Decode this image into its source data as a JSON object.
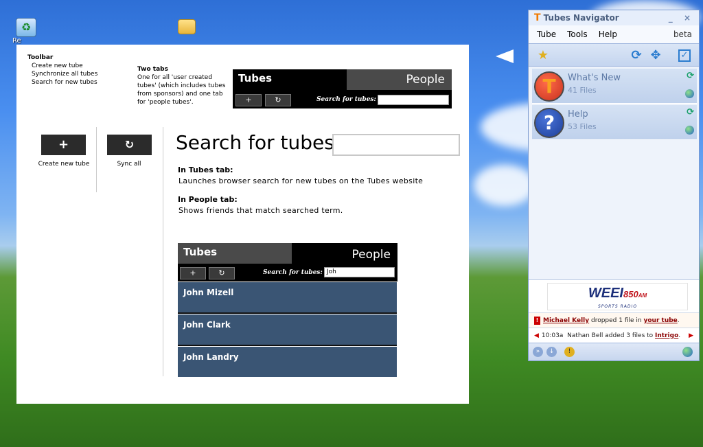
{
  "desktop": {
    "icons": [
      {
        "label": "Re"
      },
      {
        "label": ""
      }
    ]
  },
  "doc": {
    "toolbar_note": {
      "heading": "Toolbar",
      "lines": [
        "Create new tube",
        "Synchronize all tubes",
        "Search for new tubes"
      ]
    },
    "tabs_note": {
      "heading": "Two tabs",
      "lines": [
        "One for all 'user created",
        "tubes' (which includes tubes",
        "from sponsors) and one tab",
        "for 'people tubes'."
      ]
    },
    "mini_panel_top": {
      "tab_tubes": "Tubes",
      "tab_people": "People",
      "search_label": "Search for tubes:",
      "search_value": ""
    },
    "buttons": {
      "create_symbol": "+",
      "create_label": "Create new tube",
      "sync_symbol": "↻",
      "sync_label": "Sync all"
    },
    "search_heading": "Search for tubes",
    "search_value": "",
    "tubes_tab_heading": "In Tubes tab:",
    "tubes_tab_text": "Launches browser search for new tubes on the Tubes website",
    "people_tab_heading": "In People tab:",
    "people_tab_text": "Shows friends that match searched term.",
    "mini_panel_bottom": {
      "tab_tubes": "Tubes",
      "tab_people": "People",
      "search_label": "Search for tubes:",
      "search_value": "Joh"
    },
    "results": [
      "John Mizell",
      "John Clark",
      "John Landry"
    ]
  },
  "navigator": {
    "title": "Tubes Navigator",
    "title_controls": "_ ×",
    "menu": [
      "Tube",
      "Tools",
      "Help"
    ],
    "beta": "beta",
    "tubes": [
      {
        "name": "What's New",
        "files": "41 Files",
        "letter": "T",
        "color": "#c8321e"
      },
      {
        "name": "Help",
        "files": "53 Files",
        "letter": "?",
        "color": "#1d3f9a"
      }
    ],
    "ad": {
      "brand": "WEEI",
      "freq": "850",
      "unit": "AM",
      "tagline": "SPORTS RADIO"
    },
    "notice1": {
      "user": "Michael Kelly",
      "middle": " dropped 1 file in ",
      "target": "your tube",
      "end": "."
    },
    "notice2": {
      "time": "10:03a",
      "text": "Nathan Bell added 3 files to ",
      "target": "Intrigo",
      "end": "."
    }
  },
  "colors": {
    "nav_accent": "#f07a00",
    "result_row": "#3a5574",
    "link": "#8a0000"
  }
}
